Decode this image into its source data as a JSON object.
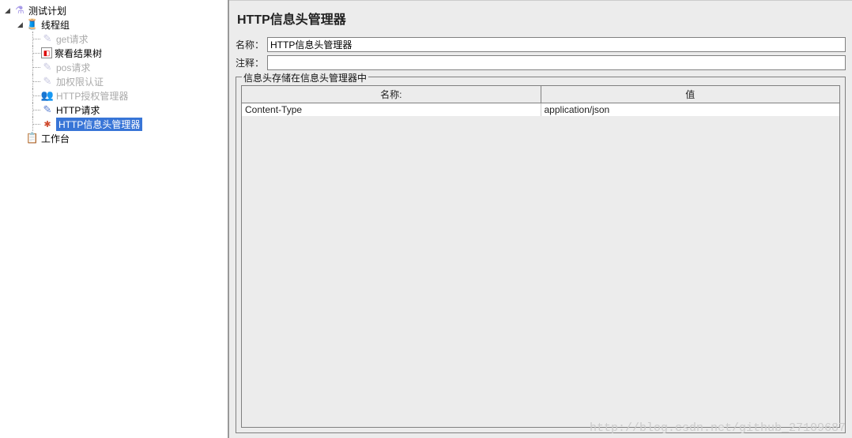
{
  "tree": {
    "root": "测试计划",
    "thread_group": "线程组",
    "items": [
      {
        "label": "get请求",
        "active": false
      },
      {
        "label": "察看结果树",
        "active": true
      },
      {
        "label": "pos请求",
        "active": false
      },
      {
        "label": "加权限认证",
        "active": false
      },
      {
        "label": "HTTP授权管理器",
        "active": false
      },
      {
        "label": "HTTP请求",
        "active": true
      },
      {
        "label": "HTTP信息头管理器",
        "active": true,
        "selected": true
      }
    ],
    "workbench": "工作台"
  },
  "panel": {
    "title": "HTTP信息头管理器",
    "name_label": "名称：",
    "name_value": "HTTP信息头管理器",
    "comment_label": "注释：",
    "comment_value": "",
    "group_title": "信息头存储在信息头管理器中",
    "table": {
      "col_name": "名称:",
      "col_value": "值",
      "rows": [
        {
          "name": "Content-Type",
          "value": "application/json"
        }
      ]
    }
  },
  "watermark": "http://blog.csdn.net/github_27109687"
}
